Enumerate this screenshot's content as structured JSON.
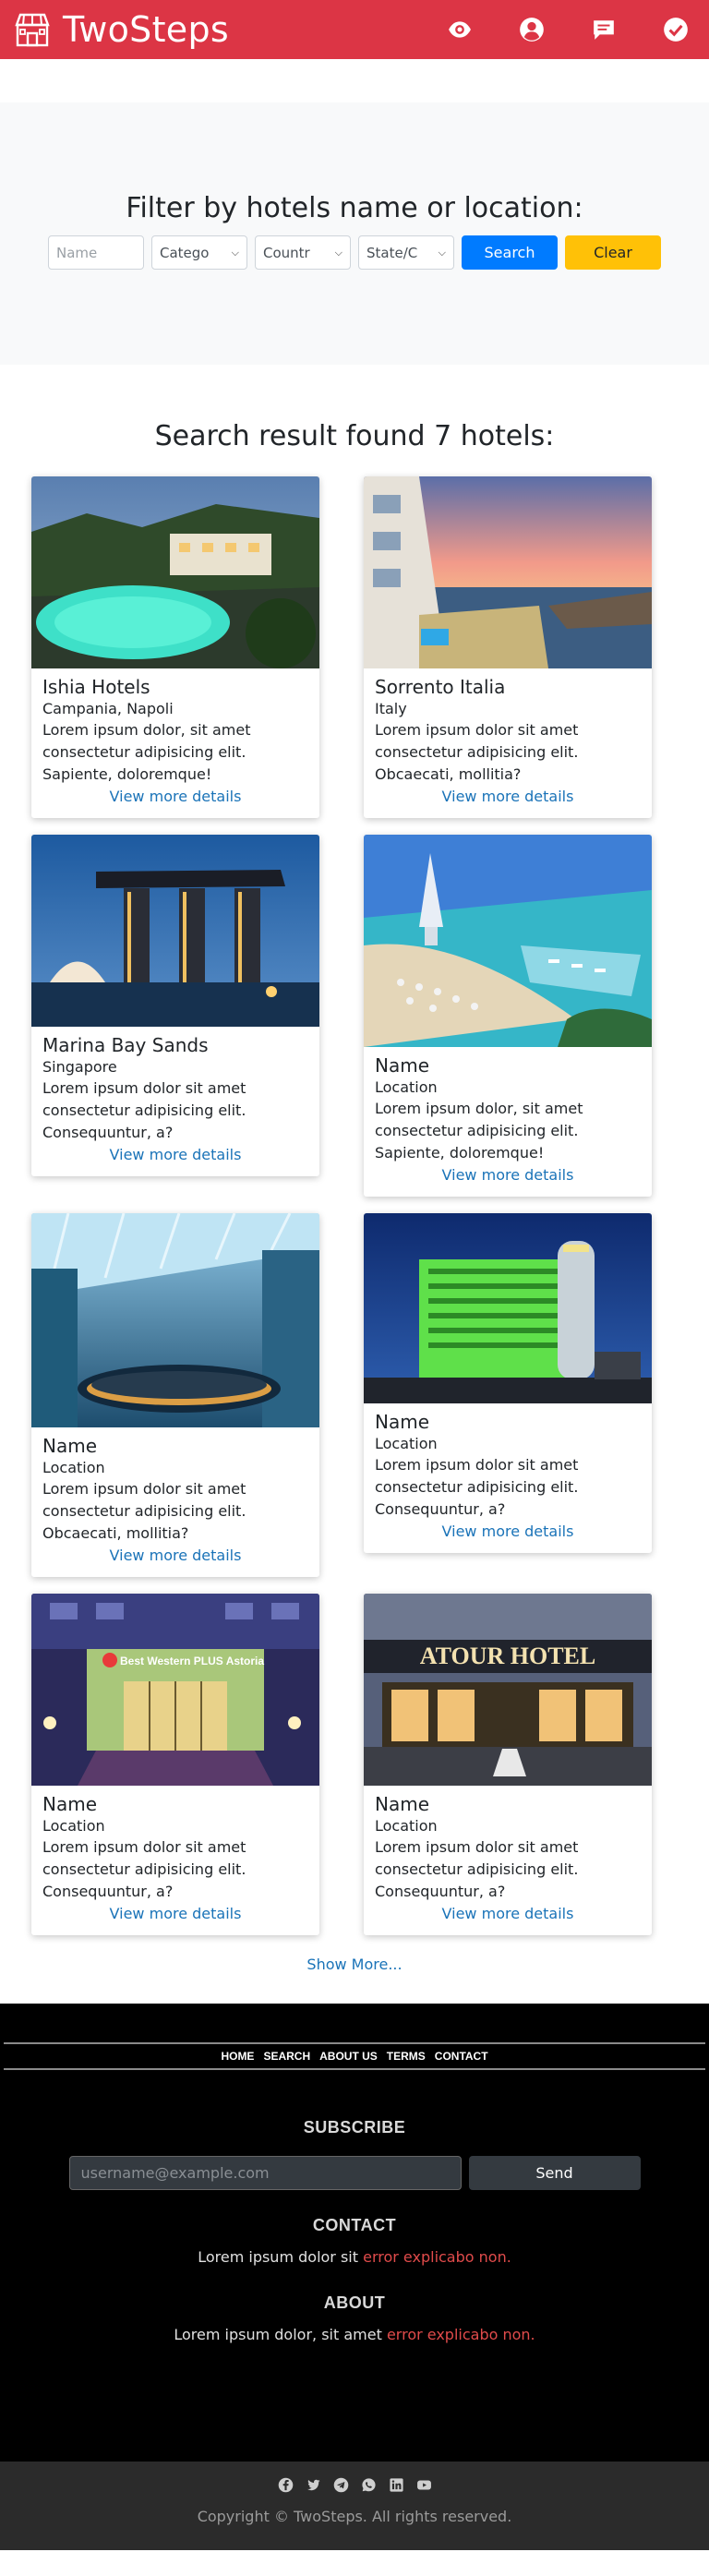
{
  "header": {
    "brand": "TwoSteps",
    "icons": [
      "eye-icon",
      "user-circle-icon",
      "message-icon",
      "check-circle-icon"
    ],
    "bg_color": "#dc3545"
  },
  "filter": {
    "title": "Filter by hotels name or location:",
    "name_placeholder": "Name",
    "category_value": "Catego",
    "country_value": "Countr",
    "state_value": "State/C",
    "search_label": "Search",
    "clear_label": "Clear"
  },
  "results": {
    "title": "Search result found 7 hotels:",
    "hotels": [
      {
        "name": "Ishia Hotels",
        "location": "Campania, Napoli",
        "desc": "Lorem ipsum dolor, sit amet consectetur adipisicing elit. Sapiente, doloremque!",
        "link": "View more details"
      },
      {
        "name": "Sorrento Italia",
        "location": "Italy",
        "desc": "Lorem ipsum dolor sit amet consectetur adipisicing elit. Obcaecati, mollitia?",
        "link": "View more details"
      },
      {
        "name": "Marina Bay Sands",
        "location": "Singapore",
        "desc": "Lorem ipsum dolor sit amet consectetur adipisicing elit. Consequuntur, a?",
        "link": "View more details"
      },
      {
        "name": "Name",
        "location": "Location",
        "desc": "Lorem ipsum dolor, sit amet consectetur adipisicing elit. Sapiente, doloremque!",
        "link": "View more details"
      },
      {
        "name": "Name",
        "location": "Location",
        "desc": "Lorem ipsum dolor sit amet consectetur adipisicing elit. Obcaecati, mollitia?",
        "link": "View more details"
      },
      {
        "name": "Name",
        "location": "Location",
        "desc": "Lorem ipsum dolor sit amet consectetur adipisicing elit. Consequuntur, a?",
        "link": "View more details"
      },
      {
        "name": "Name",
        "location": "Location",
        "desc": "Lorem ipsum dolor sit amet consectetur adipisicing elit. Consequuntur, a?",
        "link": "View more details"
      },
      {
        "name": "Name",
        "location": "Location",
        "desc": "Lorem ipsum dolor sit amet consectetur adipisicing elit. Consequuntur, a?",
        "link": "View more details"
      }
    ],
    "show_more": "Show More..."
  },
  "images": {
    "hotel_sign": "ATOUR HOTEL",
    "best_western_sign": "Best Western PLUS Astoria"
  },
  "footer": {
    "nav": [
      "HOME",
      "SEARCH",
      "ABOUT US",
      "TERMS",
      "CONTACT"
    ],
    "subscribe_heading": "SUBSCRIBE",
    "email_placeholder": "username@example.com",
    "send_label": "Send",
    "contact_heading": "CONTACT",
    "contact_text": "Lorem ipsum dolor sit",
    "contact_error": "error explicabo non.",
    "about_heading": "ABOUT",
    "about_text": "Lorem ipsum dolor, sit amet",
    "about_error": "error explicabo non.",
    "socials": [
      "facebook-icon",
      "twitter-icon",
      "telegram-icon",
      "whatsapp-icon",
      "linkedin-icon",
      "youtube-icon"
    ],
    "copyright": "Copyright © TwoSteps. All rights reserved."
  }
}
